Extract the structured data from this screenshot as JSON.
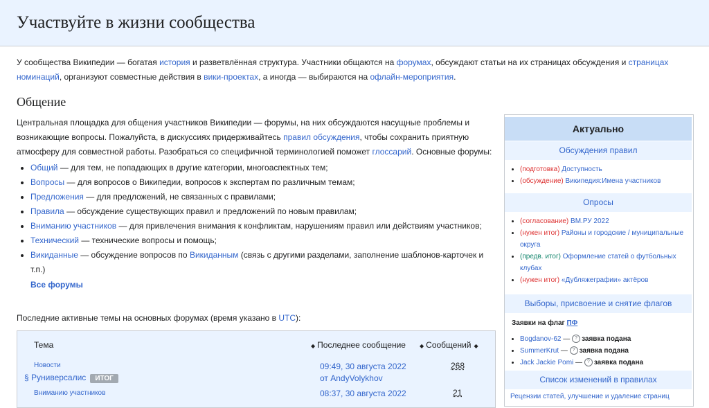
{
  "header": {
    "title": "Участвуйте в жизни сообщества"
  },
  "intro": {
    "t1": "У сообщества Википедии — богатая ",
    "l1": "история",
    "t2": " и разветвлённая структура. Участники общаются на ",
    "l2": "форумах",
    "t3": ", обсуждают статьи на их страницах обсуждения и ",
    "l3": "страницах номинаций",
    "t4": ", организуют совместные действия в ",
    "l4": "вики-проектах",
    "t5": ", а иногда — выбираются на ",
    "l5": "офлайн-мероприятия",
    "t6": "."
  },
  "section": {
    "title": "Общение",
    "p1": "Центральная площадка для общения участников Википедии — форумы, на них обсуждаются насущные проблемы и возникающие вопросы. Пожалуйста, в дискуссиях придерживайтесь ",
    "p1_link": "правил обсуждения",
    "p2": ", чтобы сохранить приятную атмосферу для совместной работы. Разобраться со специфичной терминологией поможет ",
    "p2_link": "глоссарий",
    "p3": ". Основные форумы:"
  },
  "forums": [
    {
      "link": "Общий",
      "desc": " — для тем, не попадающих в другие категории, многоаспектных тем;"
    },
    {
      "link": "Вопросы",
      "desc": " — для вопросов о Википедии, вопросов к экспертам по различным темам;"
    },
    {
      "link": "Предложения",
      "desc": " — для предложений, не связанных с правилами;"
    },
    {
      "link": "Правила",
      "desc": " — обсуждение существующих правил и предложений по новым правилам;"
    },
    {
      "link": "Вниманию участников",
      "desc": " — для привлечения внимания к конфликтам, нарушениям правил или действиям участников;"
    },
    {
      "link": "Технический",
      "desc": " — технические вопросы и помощь;"
    },
    {
      "link": "Викиданные",
      "desc": " — обсуждение вопросов по ",
      "link2": "Викиданным",
      "desc2": " (связь с другими разделами, заполнение шаблонов-карточек и т.п.)"
    }
  ],
  "all_forums": "Все форумы",
  "recent": {
    "text": "Последние активные темы на основных форумах (время указано в ",
    "link": "UTC",
    "end": "):"
  },
  "topics_table": {
    "headers": {
      "topic": "Тема",
      "last": "Последнее сообщение",
      "count": "Сообщений"
    },
    "rows": [
      {
        "section": "Новости",
        "title": "§ Руниверсалис",
        "badge": "ИТОГ",
        "date": "09:49, 30 августа 2022",
        "author": "от AndyVolykhov",
        "count": "268"
      },
      {
        "section": "Вниманию участников",
        "date": "08:37, 30 августа 2022",
        "count": "21"
      }
    ]
  },
  "sidebar": {
    "title": "Актуально",
    "rules": {
      "title": "Обсуждения правил",
      "items": [
        {
          "tag": "(подготовка)",
          "text": " Доступность"
        },
        {
          "tag": "(обсуждение)",
          "text": " Википедия:Имена участников"
        }
      ]
    },
    "polls": {
      "title": "Опросы",
      "items": [
        {
          "tag": "(согласование)",
          "text": " ВМ.РУ 2022"
        },
        {
          "tag": "(нужен итог)",
          "text": " Районы и городские / муниципальные округа"
        },
        {
          "tag": "(предв. итог)",
          "text": " Оформление статей о футбольных клубах"
        },
        {
          "tag": "(нужен итог)",
          "text": " «Дубляжеграфии» актёров"
        }
      ]
    },
    "elections": {
      "title": "Выборы, присвоение и снятие флагов",
      "flags_label": "Заявки на флаг ",
      "flags_link": "ПФ",
      "items": [
        {
          "user": "Bogdanov-62",
          "status": "заявка подана"
        },
        {
          "user": "SummerKrut",
          "status": "заявка подана"
        },
        {
          "user": "Jack Jackie Pomi",
          "status": "заявка подана"
        }
      ]
    },
    "changes": {
      "title": "Список изменений в правилах",
      "footer": "Рецензии статей, улучшение и удаление страниц"
    }
  },
  "colors": {
    "link": "#3366cc",
    "header_bg": "#eaf3ff",
    "sidebar_title_bg": "#c8ddf6",
    "tag_red": "#d33",
    "tag_green": "#14866d",
    "badge": "#a2a9b1"
  }
}
